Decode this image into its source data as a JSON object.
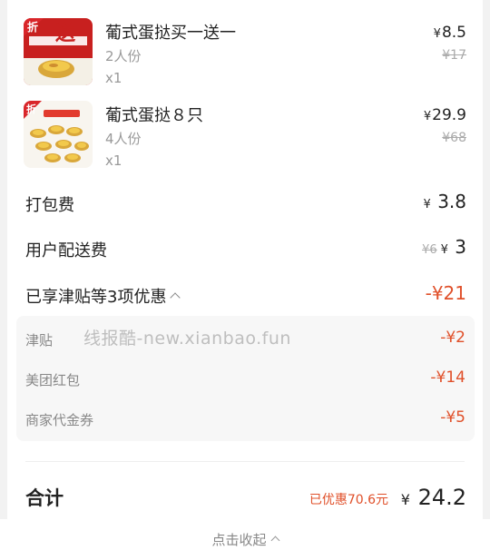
{
  "items": [
    {
      "name": "葡式蛋挞买一送一",
      "serving": "2人份",
      "qty": "x1",
      "price": "8.5",
      "orig_price": "¥17",
      "badge": "折",
      "promo_text": "送",
      "icon": "egg-tart-icon"
    },
    {
      "name": "葡式蛋挞８只",
      "serving": "4人份",
      "qty": "x1",
      "price": "29.9",
      "orig_price": "¥68",
      "badge": "折",
      "icon": "egg-tarts-icon"
    }
  ],
  "currency": "¥",
  "fees": {
    "packing_label": "打包费",
    "packing_value": "3.8",
    "delivery_label": "用户配送费",
    "delivery_orig": "¥6",
    "delivery_value": "3"
  },
  "discounts": {
    "summary_label": "已享津贴等3项优惠",
    "summary_value": "-¥21",
    "items": [
      {
        "label": "津贴",
        "value": "-¥2"
      },
      {
        "label": "美团红包",
        "value": "-¥14"
      },
      {
        "label": "商家代金券",
        "value": "-¥5"
      }
    ]
  },
  "watermark": "线报酷-new.xianbao.fun",
  "total": {
    "label": "合计",
    "saved": "已优惠70.6元",
    "value": "24.2"
  },
  "collapse_label": "点击收起",
  "colors": {
    "accent_red": "#e0502a",
    "badge_red": "#d9262a"
  }
}
